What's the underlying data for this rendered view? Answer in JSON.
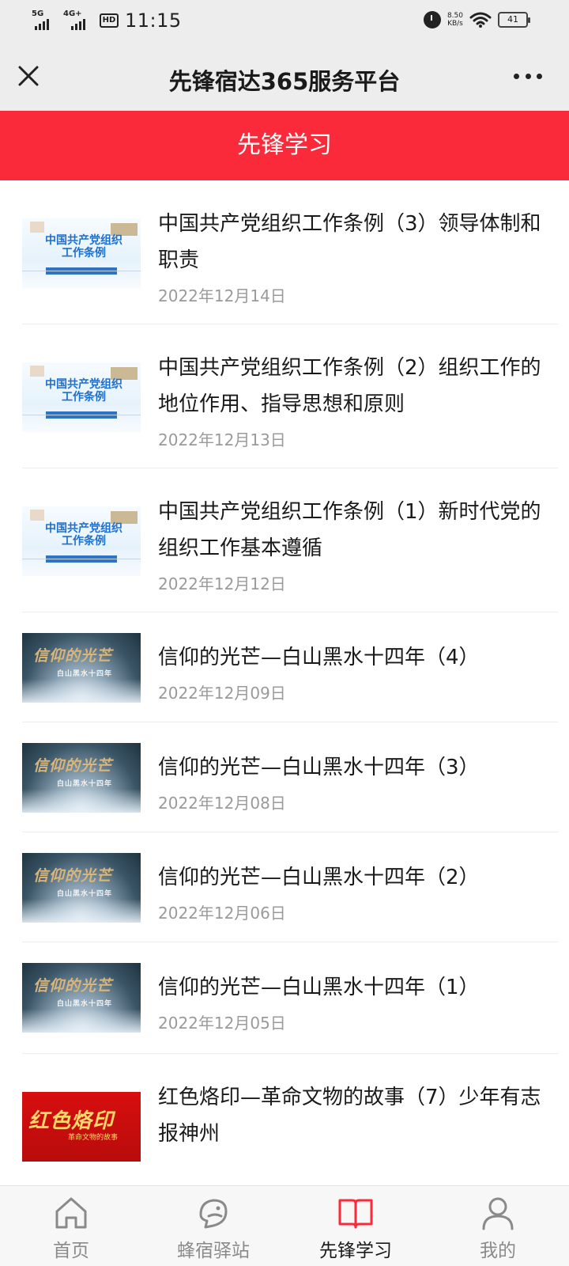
{
  "status_bar": {
    "signal1_label": "5G",
    "signal2_label": "4G+",
    "hd_label": "HD",
    "time": "11:15",
    "net_speed_value": "8.50",
    "net_speed_unit": "KB/s",
    "battery": "41"
  },
  "title_bar": {
    "title": "先锋宿达365服务平台",
    "close_icon": "close-icon",
    "more_icon": "more-icon"
  },
  "banner": {
    "label": "先锋学习"
  },
  "articles": [
    {
      "title": "中国共产党组织工作条例（3）领导体制和职责",
      "date": "2022年12月14日",
      "thumb": "org",
      "thumb_text": "中国共产党组织工作条例"
    },
    {
      "title": "中国共产党组织工作条例（2）组织工作的地位作用、指导思想和原则",
      "date": "2022年12月13日",
      "thumb": "org",
      "thumb_text": "中国共产党组织工作条例"
    },
    {
      "title": "中国共产党组织工作条例（1）新时代党的组织工作基本遵循",
      "date": "2022年12月12日",
      "thumb": "org",
      "thumb_text": "中国共产党组织工作条例"
    },
    {
      "title": "信仰的光芒—白山黑水十四年（4）",
      "date": "2022年12月09日",
      "thumb": "faith",
      "thumb_text": "信仰的光芒",
      "thumb_sub": "白山黑水十四年"
    },
    {
      "title": "信仰的光芒—白山黑水十四年（3）",
      "date": "2022年12月08日",
      "thumb": "faith",
      "thumb_text": "信仰的光芒",
      "thumb_sub": "白山黑水十四年"
    },
    {
      "title": "信仰的光芒—白山黑水十四年（2）",
      "date": "2022年12月06日",
      "thumb": "faith",
      "thumb_text": "信仰的光芒",
      "thumb_sub": "白山黑水十四年"
    },
    {
      "title": "信仰的光芒—白山黑水十四年（1）",
      "date": "2022年12月05日",
      "thumb": "faith",
      "thumb_text": "信仰的光芒",
      "thumb_sub": "白山黑水十四年"
    },
    {
      "title": "红色烙印—革命文物的故事（7）少年有志报神州",
      "date": "",
      "thumb": "red",
      "thumb_text": "红色烙印",
      "thumb_sub": "革命文物的故事"
    }
  ],
  "bottom_nav": {
    "items": [
      {
        "label": "首页",
        "icon": "home-icon",
        "active": false
      },
      {
        "label": "蜂宿驿站",
        "icon": "bird-icon",
        "active": false
      },
      {
        "label": "先锋学习",
        "icon": "book-icon",
        "active": true
      },
      {
        "label": "我的",
        "icon": "user-icon",
        "active": false
      }
    ]
  },
  "colors": {
    "accent": "#fa2a3a",
    "title_bar_bg": "#ededed",
    "date_text": "#9a9a9a"
  }
}
